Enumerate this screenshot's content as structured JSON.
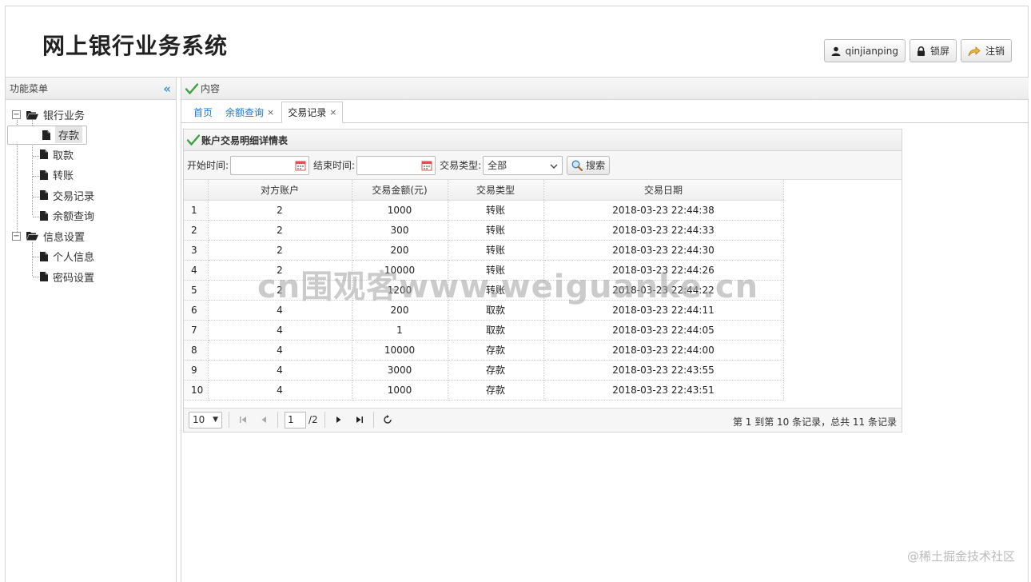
{
  "app": {
    "title": "网上银行业务系统",
    "header_buttons": [
      {
        "label": "qinjianping",
        "icon": "user-icon"
      },
      {
        "label": "锁屏",
        "icon": "lock-icon"
      },
      {
        "label": "注销",
        "icon": "logout-icon"
      }
    ]
  },
  "sidebar": {
    "title": "功能菜单",
    "collapse_icon": "double-chevron-left-icon",
    "groups": [
      {
        "label": "银行业务",
        "items": [
          {
            "label": "存款",
            "selected": true
          },
          {
            "label": "取款"
          },
          {
            "label": "转账"
          },
          {
            "label": "交易记录"
          },
          {
            "label": "余额查询"
          }
        ]
      },
      {
        "label": "信息设置",
        "items": [
          {
            "label": "个人信息"
          },
          {
            "label": "密码设置"
          }
        ]
      }
    ]
  },
  "content": {
    "title": "内容",
    "tabs": [
      {
        "label": "首页",
        "closable": false
      },
      {
        "label": "余额查询",
        "closable": true
      },
      {
        "label": "交易记录",
        "closable": true,
        "active": true
      }
    ]
  },
  "panel": {
    "title": "账户交易明细详情表",
    "filters": {
      "start_label": "开始时间:",
      "start_value": "",
      "end_label": "结束时间:",
      "end_value": "",
      "type_label": "交易类型:",
      "type_value": "全部",
      "search_label": "搜索"
    },
    "columns": [
      "对方账户",
      "交易金额(元)",
      "交易类型",
      "交易日期"
    ],
    "rows": [
      {
        "n": "1",
        "account": "2",
        "amount": "1000",
        "type": "转账",
        "kind": "transfer",
        "date": "2018-03-23 22:44:38"
      },
      {
        "n": "2",
        "account": "2",
        "amount": "300",
        "type": "转账",
        "kind": "transfer",
        "date": "2018-03-23 22:44:33"
      },
      {
        "n": "3",
        "account": "2",
        "amount": "200",
        "type": "转账",
        "kind": "transfer",
        "date": "2018-03-23 22:44:30"
      },
      {
        "n": "4",
        "account": "2",
        "amount": "10000",
        "type": "转账",
        "kind": "transfer",
        "date": "2018-03-23 22:44:26"
      },
      {
        "n": "5",
        "account": "2",
        "amount": "1200",
        "type": "转账",
        "kind": "transfer",
        "date": "2018-03-23 22:44:22"
      },
      {
        "n": "6",
        "account": "4",
        "amount": "200",
        "type": "取款",
        "kind": "withdraw",
        "date": "2018-03-23 22:44:11"
      },
      {
        "n": "7",
        "account": "4",
        "amount": "1",
        "type": "取款",
        "kind": "withdraw",
        "date": "2018-03-23 22:44:05"
      },
      {
        "n": "8",
        "account": "4",
        "amount": "10000",
        "type": "存款",
        "kind": "deposit",
        "date": "2018-03-23 22:44:00"
      },
      {
        "n": "9",
        "account": "4",
        "amount": "3000",
        "type": "存款",
        "kind": "deposit",
        "date": "2018-03-23 22:43:55"
      },
      {
        "n": "10",
        "account": "4",
        "amount": "1000",
        "type": "存款",
        "kind": "deposit",
        "date": "2018-03-23 22:43:51"
      }
    ],
    "pager": {
      "page_size": "10",
      "page": "1",
      "total_pages": "/2",
      "info": "第 1 到第 10 条记录，总共 11 条记录"
    }
  },
  "watermarks": {
    "center": "cn围观客www.weiguanke.cn",
    "corner": "@稀土掘金技术社区"
  },
  "colors": {
    "transfer": "#1a1aa6",
    "withdraw": "#d40000",
    "accent": "#3b8fd6",
    "check": "#3aa33a"
  }
}
